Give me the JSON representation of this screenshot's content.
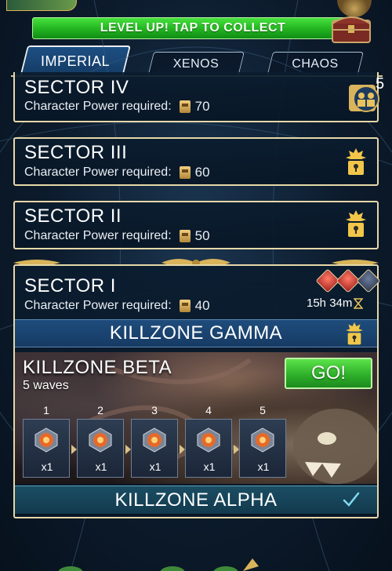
{
  "levelup": {
    "label": "LEVEL UP! TAP TO COLLECT"
  },
  "tabs": [
    {
      "label": "IMPERIAL",
      "active": true
    },
    {
      "label": "XENOS",
      "active": false
    },
    {
      "label": "CHAOS",
      "active": false
    }
  ],
  "sectors": {
    "iv": {
      "title": "SECTOR IV",
      "req_label": "Character Power required:",
      "req_value": "70",
      "badge_count": "5"
    },
    "iii": {
      "title": "SECTOR III",
      "req_label": "Character Power required:",
      "req_value": "60"
    },
    "ii": {
      "title": "SECTOR II",
      "req_label": "Character Power required:",
      "req_value": "50"
    },
    "i": {
      "title": "SECTOR I",
      "req_label": "Character Power required:",
      "req_value": "40",
      "timer": "15h 34m"
    }
  },
  "killzones": {
    "gamma": {
      "label": "KILLZONE GAMMA"
    },
    "beta": {
      "label": "KILLZONE BETA",
      "waves_label": "5 waves",
      "go_label": "GO!",
      "waves": [
        {
          "num": "1",
          "count": "x1"
        },
        {
          "num": "2",
          "count": "x1"
        },
        {
          "num": "3",
          "count": "x1"
        },
        {
          "num": "4",
          "count": "x1"
        },
        {
          "num": "5",
          "count": "x1"
        }
      ]
    },
    "alpha": {
      "label": "KILLZONE ALPHA"
    }
  },
  "colors": {
    "accent_green": "#2fb02a",
    "gold_border": "#e6d8a8",
    "panel_blue": "#163b64"
  }
}
